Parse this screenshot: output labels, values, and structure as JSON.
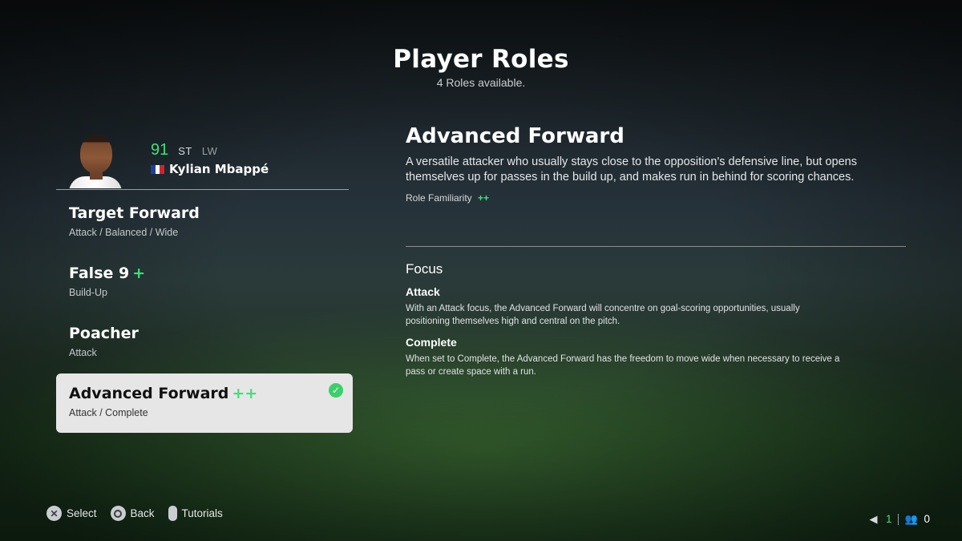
{
  "header": {
    "title": "Player Roles",
    "subtitle": "4 Roles available."
  },
  "player": {
    "rating": "91",
    "positions": [
      "ST",
      "LW"
    ],
    "name": "Kylian Mbappé",
    "flag_colors": [
      "#1f3fa0",
      "#ffffff",
      "#d1232f"
    ],
    "avatar_icon": "player-portrait"
  },
  "roles": [
    {
      "name": "Target Forward",
      "plus": "",
      "sub": "Attack / Balanced / Wide",
      "selected": false
    },
    {
      "name": "False 9",
      "plus": "+",
      "sub": "Build-Up",
      "selected": false
    },
    {
      "name": "Poacher",
      "plus": "",
      "sub": "Attack",
      "selected": false
    },
    {
      "name": "Advanced Forward",
      "plus": "++",
      "sub": "Attack / Complete",
      "selected": true
    }
  ],
  "detail": {
    "title": "Advanced Forward",
    "description": "A versatile attacker who usually stays close to the opposition's defensive line, but opens themselves up for passes in the build up, and makes run in behind for scoring chances.",
    "familiarity_label": "Role Familiarity",
    "familiarity_value": "++",
    "focus_heading": "Focus",
    "focus_items": [
      {
        "title": "Attack",
        "text": "With an Attack focus, the Advanced Forward will concentre on goal-scoring opportunities, usually positioning themselves high and central on the pitch."
      },
      {
        "title": "Complete",
        "text": "When set to Complete, the Advanced Forward has the freedom to move wide when necessary to receive a pass or create space with a run."
      }
    ]
  },
  "footer": {
    "hints": [
      {
        "icon": "cross-button-icon",
        "glyph": "✕",
        "label": "Select"
      },
      {
        "icon": "circle-button-icon",
        "glyph": "",
        "label": "Back"
      },
      {
        "icon": "touchpad-button-icon",
        "glyph": "",
        "label": "Tutorials"
      }
    ]
  },
  "status": {
    "notifications": "1",
    "friends": "0",
    "accent": "#3ee07a"
  }
}
